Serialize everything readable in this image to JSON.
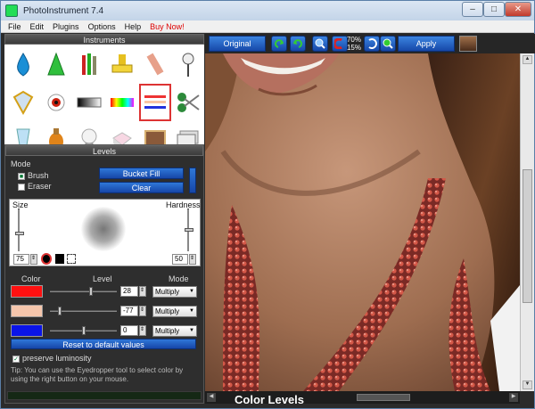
{
  "window": {
    "title": "PhotoInstrument 7.4",
    "controls": [
      "–",
      "□",
      "✕"
    ]
  },
  "menu": [
    "File",
    "Edit",
    "Plugins",
    "Options",
    "Help",
    "Buy Now!"
  ],
  "instruments": {
    "header": "Instruments",
    "selected": "Levels",
    "tools": [
      "Drop",
      "Cone",
      "Brushes",
      "Stamp",
      "Eraser",
      "Pin",
      "Diamond",
      "Eye",
      "Gradient",
      "Color strip",
      "Levels",
      "Scissors",
      "Cup",
      "Vase",
      "Bulb",
      "Box",
      "Picture",
      "Text"
    ]
  },
  "levels": {
    "header": "Levels",
    "mode_label": "Mode",
    "brush_label": "Brush",
    "eraser_label": "Eraser",
    "bucket_fill": "Bucket Fill",
    "clear": "Clear",
    "size_label": "Size",
    "hardness_label": "Hardness",
    "size_value": "75",
    "hardness_value": "50",
    "col_color": "Color",
    "col_level": "Level",
    "col_mode": "Mode",
    "rows": [
      {
        "color": "#ff1010",
        "level": "28",
        "mode": "Multiply",
        "fill": 0.62
      },
      {
        "color": "#f5c6ac",
        "level": "-77",
        "mode": "Multiply",
        "fill": 0.12
      },
      {
        "color": "#0a14e8",
        "level": "0",
        "mode": "Multiply",
        "fill": 0.5
      }
    ],
    "reset": "Reset to default values",
    "preserve_label": "preserve luminosity",
    "tip": "Tip: You can use the Eyedropper tool to select color by using the right button on your mouse."
  },
  "toolbar": {
    "original": "Original",
    "zoom_top": "70%",
    "zoom_bottom": "15%",
    "apply": "Apply"
  },
  "caption": "Color Levels"
}
